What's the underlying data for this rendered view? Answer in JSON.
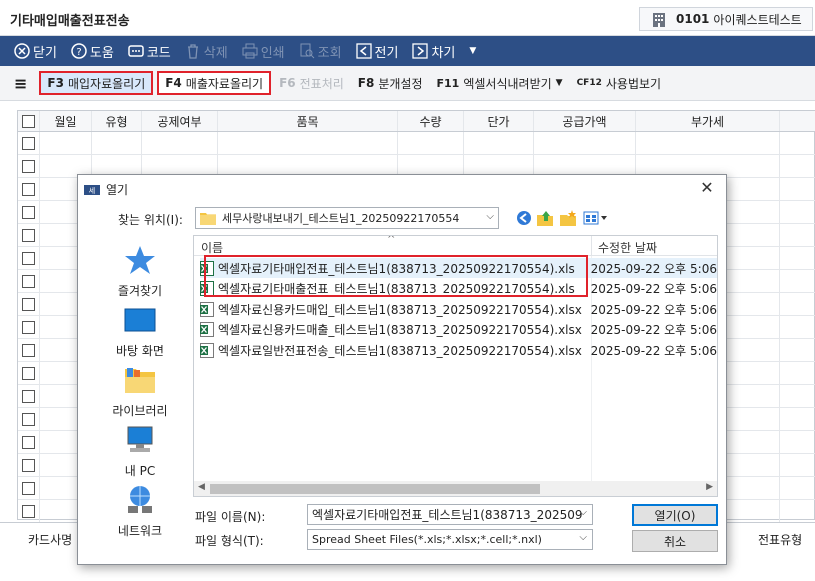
{
  "app": {
    "title": "기타매입매출전표전송",
    "company_code": "0101",
    "company_name": "아이퀘스트테스트"
  },
  "toolbar": {
    "close": "닫기",
    "help": "도움",
    "code": "코드",
    "delete": "삭제",
    "print": "인쇄",
    "search": "조회",
    "prev": "전기",
    "next": "차기"
  },
  "funcbar": {
    "f3_key": "F3",
    "f3_label": "매입자료올리기",
    "f4_key": "F4",
    "f4_label": "매출자료올리기",
    "f6_key": "F6",
    "f6_label": "전표처리",
    "f8_key": "F8",
    "f8_label": "분개설정",
    "f11_key": "F11",
    "f11_label": "엑셀서식내려받기",
    "cf12_key": "CF12",
    "cf12_label": "사용법보기"
  },
  "grid": {
    "columns": [
      "월일",
      "유형",
      "공제여부",
      "품목",
      "수량",
      "단가",
      "공급가액",
      "부가세"
    ]
  },
  "bottom": {
    "card_label": "카드사명",
    "type_label": "전표유형"
  },
  "dialog": {
    "title": "열기",
    "look_in_label": "찾는 위치(I):",
    "look_in_value": "세무사랑내보내기_테스트님1_20250922170554",
    "places": [
      "즐겨찾기",
      "바탕 화면",
      "라이브러리",
      "내 PC",
      "네트워크"
    ],
    "col_name": "이름",
    "col_date": "수정한 날짜",
    "files": [
      {
        "name": "엑셀자료기타매입전표_테스트님1(838713_20250922170554).xls",
        "date": "2025-09-22 오후 5:06"
      },
      {
        "name": "엑셀자료기타매출전표_테스트님1(838713_20250922170554).xls",
        "date": "2025-09-22 오후 5:06"
      },
      {
        "name": "엑셀자료신용카드매입_테스트님1(838713_20250922170554).xlsx",
        "date": "2025-09-22 오후 5:06"
      },
      {
        "name": "엑셀자료신용카드매출_테스트님1(838713_20250922170554).xlsx",
        "date": "2025-09-22 오후 5:06"
      },
      {
        "name": "엑셀자료일반전표전송_테스트님1(838713_20250922170554).xlsx",
        "date": "2025-09-22 오후 5:06"
      }
    ],
    "filename_label": "파일 이름(N):",
    "filename_value": "엑셀자료기타매입전표_테스트님1(838713_202509",
    "filetype_label": "파일 형식(T):",
    "filetype_value": "Spread Sheet Files(*.xls;*.xlsx;*.cell;*.nxl)",
    "open_button": "열기(O)",
    "cancel_button": "취소"
  },
  "colors": {
    "toolbar_bg": "#2d4f86",
    "highlight_border": "#e0222b",
    "excel_green": "#1d7044"
  }
}
